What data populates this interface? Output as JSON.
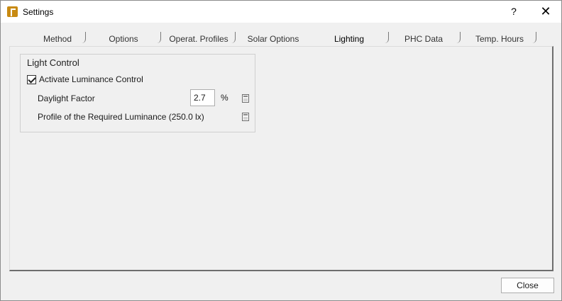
{
  "window": {
    "title": "Settings",
    "help_label": "?",
    "close_label": "✕"
  },
  "tabs": [
    {
      "label": "Method",
      "active": false
    },
    {
      "label": "Options",
      "active": false
    },
    {
      "label": "Operat. Profiles",
      "active": false
    },
    {
      "label": "Solar Options",
      "active": false
    },
    {
      "label": "Lighting",
      "active": true
    },
    {
      "label": "PHC Data",
      "active": false
    },
    {
      "label": "Temp. Hours",
      "active": false
    }
  ],
  "light_control": {
    "group_title": "Light Control",
    "activate_label": "Activate Luminance Control",
    "activate_checked": true,
    "daylight_factor_label": "Daylight Factor",
    "daylight_factor_value": "2.7",
    "daylight_factor_unit": "%",
    "profile_label": "Profile of the Required Luminance (250.0 lx)"
  },
  "footer": {
    "close_label": "Close"
  },
  "icons": {
    "app": "app-logo-icon",
    "calculator": "calculator-icon"
  },
  "colors": {
    "app_icon": "#c88a12",
    "titlebar": "#ffffff",
    "dialog_bg": "#f0f0f0"
  }
}
